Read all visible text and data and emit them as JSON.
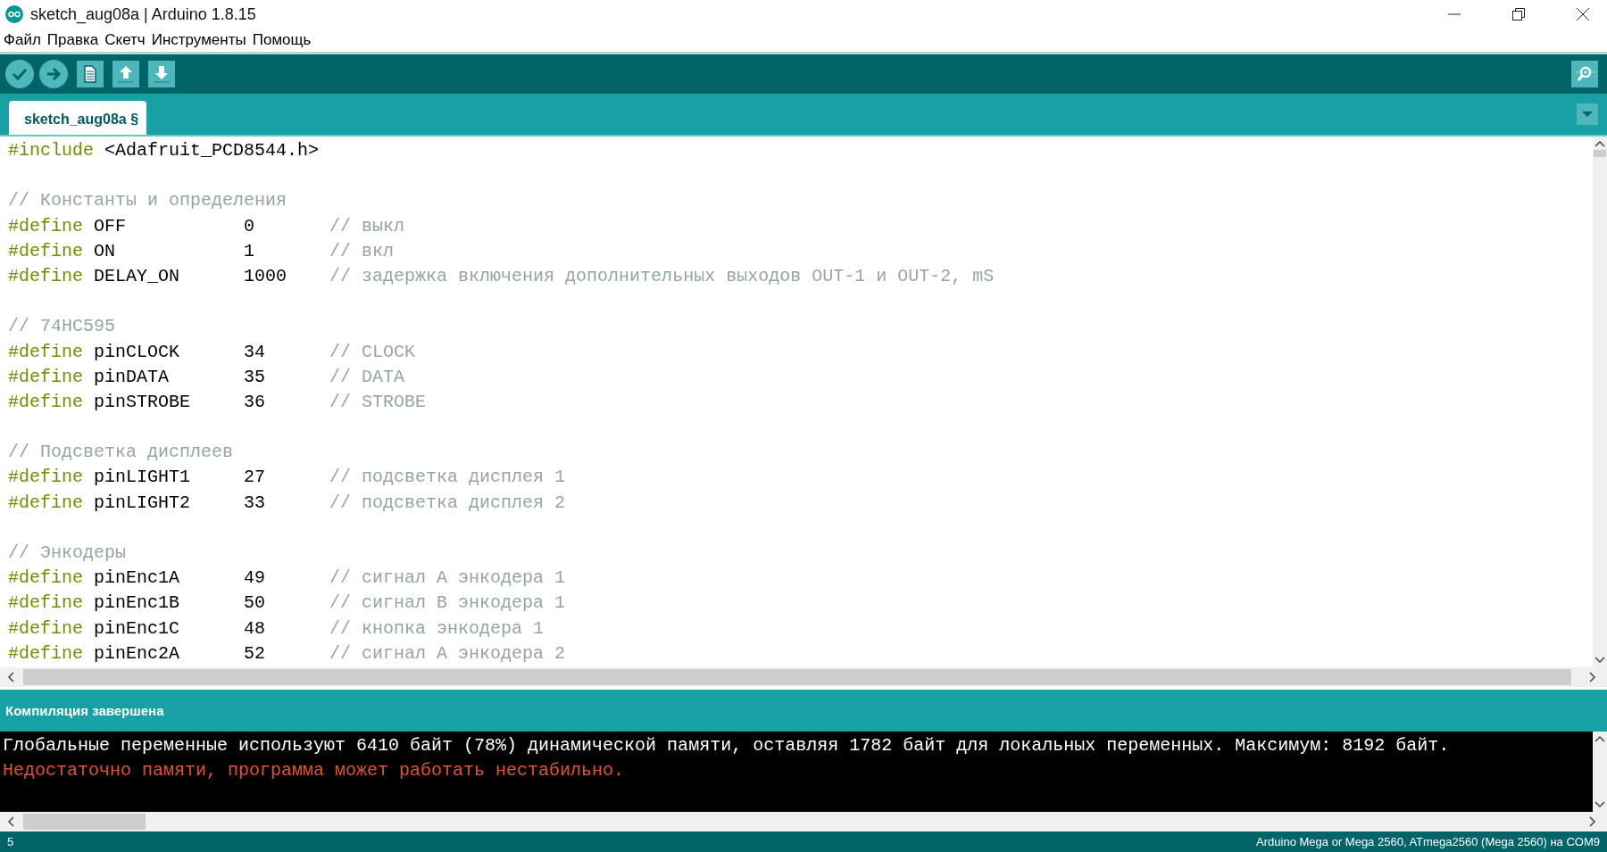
{
  "window": {
    "title": "sketch_aug08a | Arduino 1.8.15"
  },
  "menu": [
    "Файл",
    "Правка",
    "Скетч",
    "Инструменты",
    "Помощь"
  ],
  "tabs": [
    {
      "label": "sketch_aug08a §",
      "selected": true
    }
  ],
  "code_lines": [
    {
      "tokens": [
        {
          "kind": "keyword",
          "text": "#include"
        },
        {
          "kind": "plain",
          "text": " <Adafruit_PCD8544.h>"
        }
      ]
    },
    {
      "kind": "blank"
    },
    {
      "tokens": [
        {
          "kind": "comment",
          "text": "// Константы и определения"
        }
      ]
    },
    {
      "tokens": [
        {
          "kind": "keyword",
          "text": "#define"
        },
        {
          "kind": "plain",
          "text": " OFF           0       "
        },
        {
          "kind": "comment",
          "text": "// выкл"
        }
      ]
    },
    {
      "tokens": [
        {
          "kind": "keyword",
          "text": "#define"
        },
        {
          "kind": "plain",
          "text": " ON            1       "
        },
        {
          "kind": "comment",
          "text": "// вкл"
        }
      ]
    },
    {
      "tokens": [
        {
          "kind": "keyword",
          "text": "#define"
        },
        {
          "kind": "plain",
          "text": " DELAY_ON      1000    "
        },
        {
          "kind": "comment",
          "text": "// задержка включения дополнительных выходов OUT-1 и OUT-2, mS"
        }
      ]
    },
    {
      "kind": "blank"
    },
    {
      "tokens": [
        {
          "kind": "comment",
          "text": "// 74HC595"
        }
      ]
    },
    {
      "tokens": [
        {
          "kind": "keyword",
          "text": "#define"
        },
        {
          "kind": "plain",
          "text": " pinCLOCK      34      "
        },
        {
          "kind": "comment",
          "text": "// CLOCK"
        }
      ]
    },
    {
      "tokens": [
        {
          "kind": "keyword",
          "text": "#define"
        },
        {
          "kind": "plain",
          "text": " pinDATA       35      "
        },
        {
          "kind": "comment",
          "text": "// DATA"
        }
      ]
    },
    {
      "tokens": [
        {
          "kind": "keyword",
          "text": "#define"
        },
        {
          "kind": "plain",
          "text": " pinSTROBE     36      "
        },
        {
          "kind": "comment",
          "text": "// STROBE"
        }
      ]
    },
    {
      "kind": "blank"
    },
    {
      "tokens": [
        {
          "kind": "comment",
          "text": "// Подсветка дисплеев"
        }
      ]
    },
    {
      "tokens": [
        {
          "kind": "keyword",
          "text": "#define"
        },
        {
          "kind": "plain",
          "text": " pinLIGHT1     27      "
        },
        {
          "kind": "comment",
          "text": "// подсветка дисплея 1"
        }
      ]
    },
    {
      "tokens": [
        {
          "kind": "keyword",
          "text": "#define"
        },
        {
          "kind": "plain",
          "text": " pinLIGHT2     33      "
        },
        {
          "kind": "comment",
          "text": "// подсветка дисплея 2"
        }
      ]
    },
    {
      "kind": "blank"
    },
    {
      "tokens": [
        {
          "kind": "comment",
          "text": "// Энкодеры"
        }
      ]
    },
    {
      "tokens": [
        {
          "kind": "keyword",
          "text": "#define"
        },
        {
          "kind": "plain",
          "text": " pinEnc1A      49      "
        },
        {
          "kind": "comment",
          "text": "// сигнал А энкодера 1"
        }
      ]
    },
    {
      "tokens": [
        {
          "kind": "keyword",
          "text": "#define"
        },
        {
          "kind": "plain",
          "text": " pinEnc1B      50      "
        },
        {
          "kind": "comment",
          "text": "// сигнал В энкодера 1"
        }
      ]
    },
    {
      "tokens": [
        {
          "kind": "keyword",
          "text": "#define"
        },
        {
          "kind": "plain",
          "text": " pinEnc1C      48      "
        },
        {
          "kind": "comment",
          "text": "// кнопка энкодера 1"
        }
      ]
    },
    {
      "tokens": [
        {
          "kind": "keyword",
          "text": "#define"
        },
        {
          "kind": "plain",
          "text": " pinEnc2A      52      "
        },
        {
          "kind": "comment",
          "text": "// сигнал А энкодера 2"
        }
      ]
    }
  ],
  "console": {
    "status": "Компиляция завершена",
    "lines": [
      {
        "kind": "info",
        "text": "Глобальные переменные используют 6410 байт (78%) динамической памяти, оставляя 1782 байт для локальных переменных. Максимум: 8192 байт."
      },
      {
        "kind": "error",
        "text": "Недостаточно памяти, программа может работать нестабильно."
      }
    ]
  },
  "status_bar": {
    "line": "5",
    "board": "Arduino Mega or Mega 2560, ATmega2560 (Mega 2560) на COM9"
  }
}
